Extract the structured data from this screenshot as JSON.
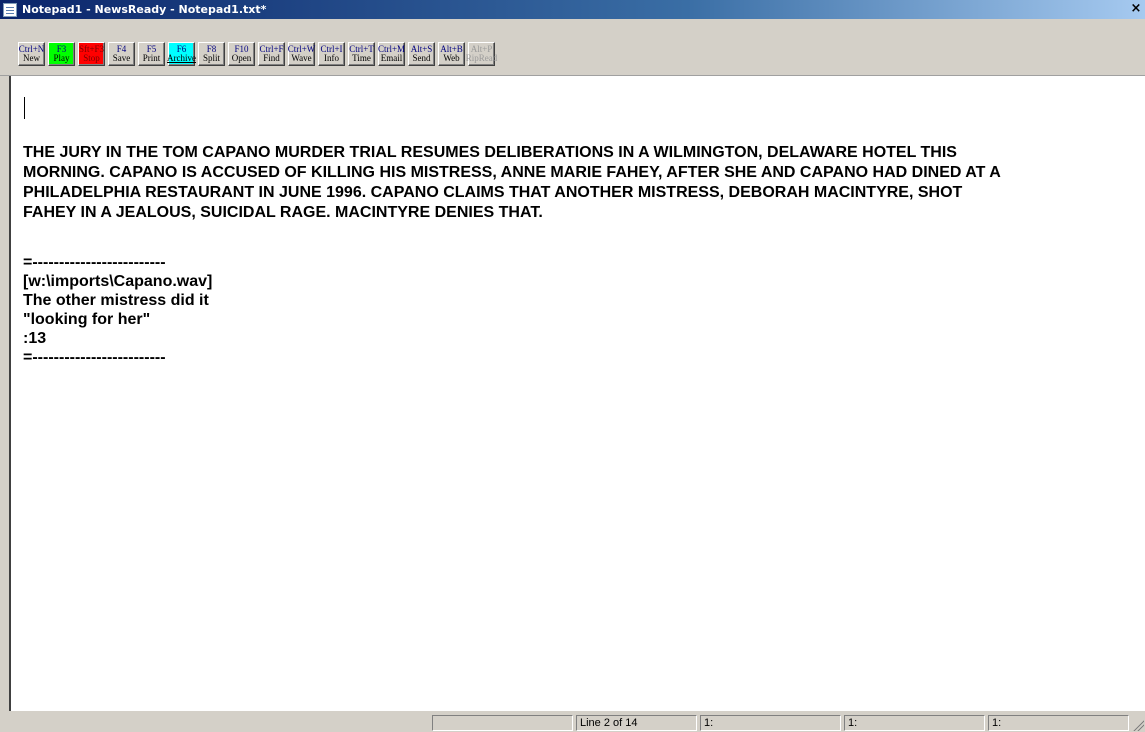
{
  "window": {
    "title": "Notepad1 - NewsReady - Notepad1.txt*",
    "close_glyph": "×",
    "title_icon": "notepad-icon"
  },
  "toolbar": {
    "buttons": [
      {
        "key": "Ctrl+N",
        "label": "New",
        "style": "normal"
      },
      {
        "key": "F3",
        "label": "Play",
        "style": "green"
      },
      {
        "key": "Sft+F3",
        "label": "Stop",
        "style": "red"
      },
      {
        "key": "F4",
        "label": "Save",
        "style": "normal"
      },
      {
        "key": "F5",
        "label": "Print",
        "style": "normal"
      },
      {
        "key": "F6",
        "label": "Archive",
        "style": "cyan"
      },
      {
        "key": "F8",
        "label": "Split",
        "style": "normal"
      },
      {
        "key": "F10",
        "label": "Open",
        "style": "normal"
      },
      {
        "key": "Ctrl+F",
        "label": "Find",
        "style": "normal"
      },
      {
        "key": "Ctrl+W",
        "label": "Wave",
        "style": "normal"
      },
      {
        "key": "Ctrl+I",
        "label": "Info",
        "style": "normal"
      },
      {
        "key": "Ctrl+T",
        "label": "Time",
        "style": "normal"
      },
      {
        "key": "Ctrl+M",
        "label": "Email",
        "style": "normal"
      },
      {
        "key": "Alt+S",
        "label": "Send",
        "style": "normal"
      },
      {
        "key": "Alt+B",
        "label": "Web",
        "style": "normal"
      },
      {
        "key": "Alt+P",
        "label": "RipRead",
        "style": "disabled"
      }
    ]
  },
  "editor": {
    "paragraph_lines": [
      "THE JURY IN THE TOM CAPANO MURDER TRIAL RESUMES DELIBERATIONS IN A WILMINGTON, DELAWARE HOTEL THIS",
      "MORNING. CAPANO IS ACCUSED OF KILLING HIS MISTRESS, ANNE MARIE FAHEY, AFTER SHE AND CAPANO HAD DINED AT A",
      "PHILADELPHIA RESTAURANT IN JUNE 1996. CAPANO CLAIMS THAT ANOTHER MISTRESS, DEBORAH MACINTYRE, SHOT",
      "FAHEY IN A JEALOUS, SUICIDAL RAGE. MACINTYRE DENIES THAT."
    ],
    "cue_block": {
      "separator_top": "=-------------------------",
      "file": "[w:\\imports\\Capano.wav]",
      "description": "The other mistress did it",
      "outcue": "\"looking for her\"",
      "duration": ":13",
      "separator_bottom": "=-------------------------"
    }
  },
  "statusbar": {
    "panel1": "",
    "line_info": "Line 2 of 14",
    "panel3": "1:",
    "panel4": "1:",
    "panel5": "1:"
  }
}
